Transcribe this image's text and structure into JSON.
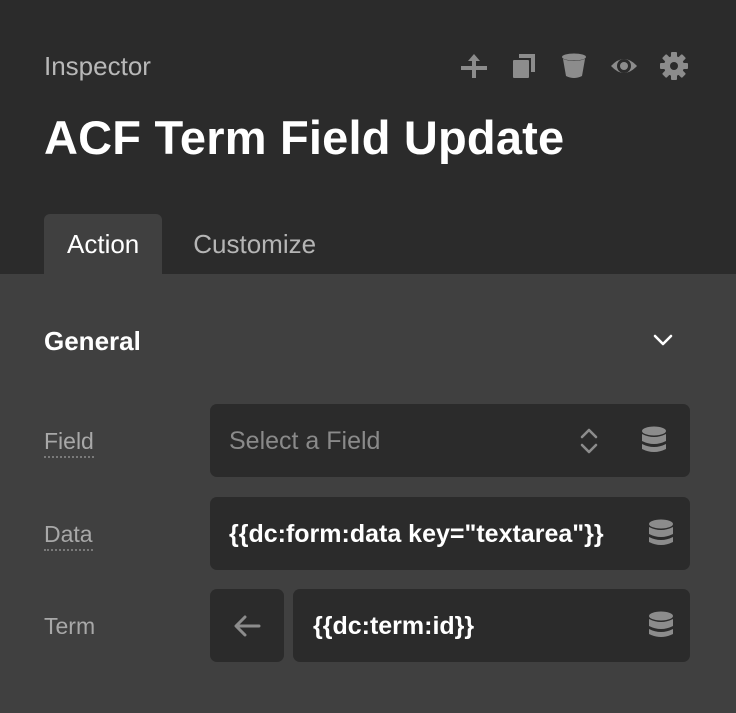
{
  "header": {
    "inspector_label": "Inspector",
    "title": "ACF Term Field Update",
    "toolbar_icons": [
      "move-up-icon",
      "duplicate-icon",
      "delete-icon",
      "visibility-icon",
      "settings-icon"
    ]
  },
  "tabs": [
    {
      "label": "Action",
      "active": true
    },
    {
      "label": "Customize",
      "active": false
    }
  ],
  "section": {
    "title": "General",
    "expanded": true
  },
  "fields": {
    "field": {
      "label": "Field",
      "placeholder": "Select a Field"
    },
    "data": {
      "label": "Data",
      "value": "{{dc:form:data key=\"textarea\"}}"
    },
    "term": {
      "label": "Term",
      "value": "{{dc:term:id}}"
    }
  },
  "colors": {
    "header_bg": "#2b2b2b",
    "panel_bg": "#404040",
    "control_bg": "#2b2b2b",
    "icon": "#8c8c8c",
    "text_primary": "#ffffff",
    "text_muted": "#a8a8a8"
  }
}
